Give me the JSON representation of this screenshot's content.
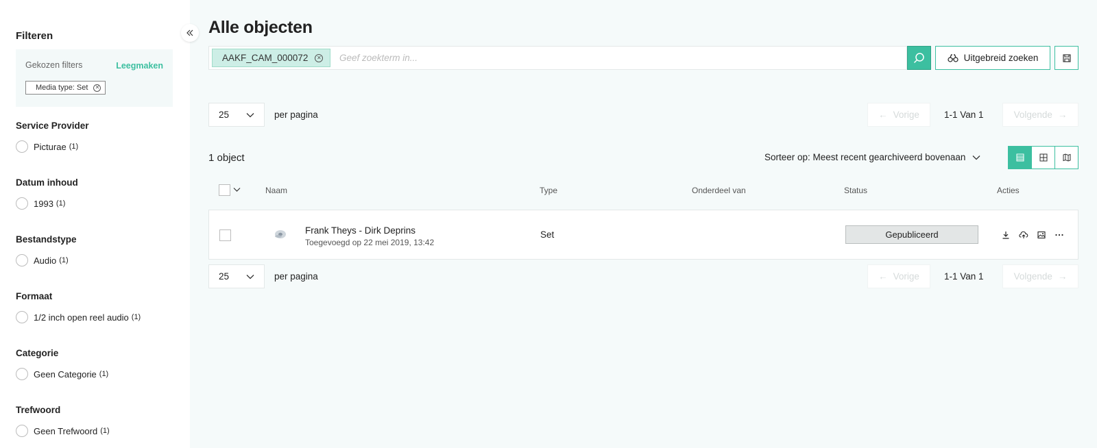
{
  "sidebar": {
    "title": "Filteren",
    "chosen_label": "Gekozen filters",
    "clear_label": "Leegmaken",
    "active_filter": "Media type: Set",
    "facets": [
      {
        "title": "Service Provider",
        "option": "Picturae",
        "count": "(1)"
      },
      {
        "title": "Datum inhoud",
        "option": "1993",
        "count": "(1)"
      },
      {
        "title": "Bestandstype",
        "option": "Audio",
        "count": "(1)"
      },
      {
        "title": "Formaat",
        "option": "1/2 inch open reel audio",
        "count": "(1)"
      },
      {
        "title": "Categorie",
        "option": "Geen Categorie",
        "count": "(1)"
      },
      {
        "title": "Trefwoord",
        "option": "Geen Trefwoord",
        "count": "(1)"
      }
    ]
  },
  "main": {
    "title": "Alle objecten",
    "search": {
      "tag": "AAKF_CAM_000072",
      "placeholder": "Geef zoekterm in...",
      "advanced_label": "Uitgebreid zoeken"
    },
    "per_page_value": "25",
    "per_page_label": "per pagina",
    "pager": {
      "prev": "Vorige",
      "next": "Volgende",
      "info": "1-1 Van 1"
    },
    "count_label": "1 object",
    "sort_label": "Sorteer op: Meest recent gearchiveerd bovenaan",
    "columns": {
      "name": "Naam",
      "type": "Type",
      "part_of": "Onderdeel van",
      "status": "Status",
      "actions": "Acties"
    },
    "rows": [
      {
        "title": "Frank Theys - Dirk Deprins",
        "subtitle": "Toegevoegd op 22 mei 2019, 13:42",
        "type": "Set",
        "part_of": "",
        "status": "Gepubliceerd"
      }
    ]
  },
  "colors": {
    "accent": "#3cbfa0",
    "background": "#f5fafa",
    "status_bg": "#e3e6e6"
  },
  "icons": [
    "double-chevron-left-icon",
    "close-circle-icon",
    "search-icon",
    "binoculars-icon",
    "save-icon",
    "chevron-down-icon",
    "arrow-left-icon",
    "arrow-right-icon",
    "list-view-icon",
    "grid-view-icon",
    "map-view-icon",
    "download-icon",
    "cloud-upload-icon",
    "image-icon",
    "more-icon",
    "audio-reel-icon"
  ]
}
